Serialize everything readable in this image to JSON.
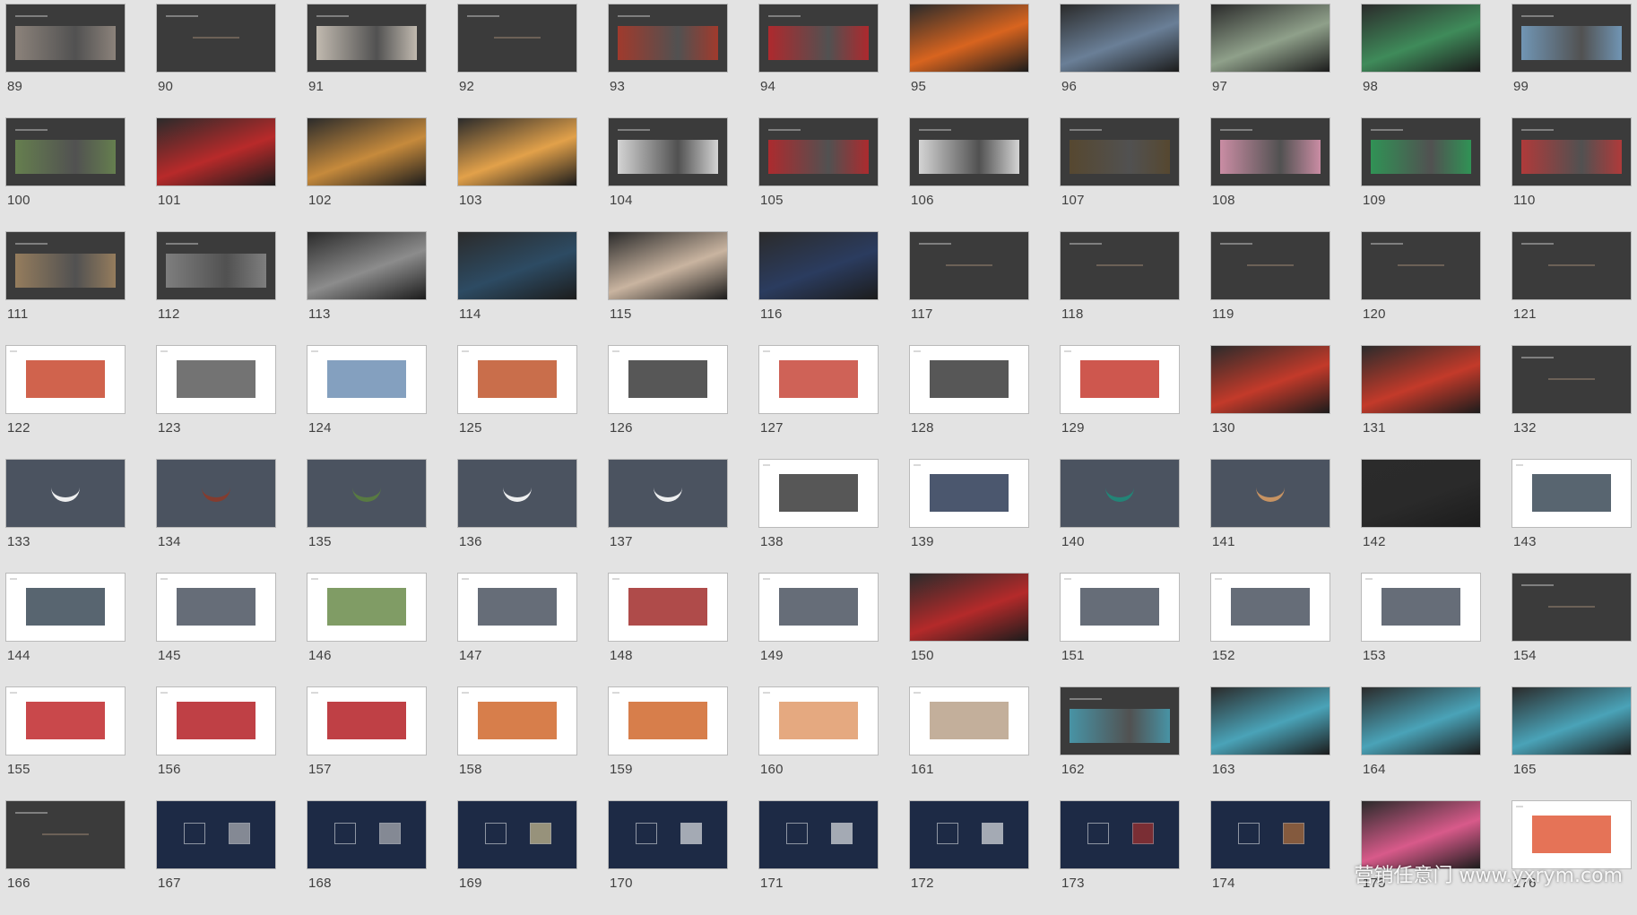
{
  "view": "slide-sorter",
  "slides": [
    {
      "number": "89",
      "theme": "dark",
      "accent": "#9a8f86"
    },
    {
      "number": "90",
      "theme": "dark",
      "accent": ""
    },
    {
      "number": "91",
      "theme": "dark",
      "accent": "#d9d0c4"
    },
    {
      "number": "92",
      "theme": "dark",
      "accent": ""
    },
    {
      "number": "93",
      "theme": "dark",
      "accent": "#b23a2a"
    },
    {
      "number": "94",
      "theme": "dark",
      "accent": "#c2262b"
    },
    {
      "number": "95",
      "theme": "photo",
      "accent": "#d8641f"
    },
    {
      "number": "96",
      "theme": "photo",
      "accent": "#6a7f97"
    },
    {
      "number": "97",
      "theme": "photo",
      "accent": "#8fa08a"
    },
    {
      "number": "98",
      "theme": "photo",
      "accent": "#3f8b5a"
    },
    {
      "number": "99",
      "theme": "dark",
      "accent": "#7aa5c9"
    },
    {
      "number": "100",
      "theme": "dark",
      "accent": "#6d8b52"
    },
    {
      "number": "101",
      "theme": "photo",
      "accent": "#b82a2a"
    },
    {
      "number": "102",
      "theme": "photo",
      "accent": "#c68a3c"
    },
    {
      "number": "103",
      "theme": "photo",
      "accent": "#e2a14a"
    },
    {
      "number": "104",
      "theme": "dark",
      "accent": "#efefef"
    },
    {
      "number": "105",
      "theme": "dark",
      "accent": "#c0282c"
    },
    {
      "number": "106",
      "theme": "dark",
      "accent": "#efefef"
    },
    {
      "number": "107",
      "theme": "dark",
      "accent": "#5b4a2e"
    },
    {
      "number": "108",
      "theme": "dark",
      "accent": "#e39bb6"
    },
    {
      "number": "109",
      "theme": "dark",
      "accent": "#2ea25a"
    },
    {
      "number": "110",
      "theme": "dark",
      "accent": "#c43a3a"
    },
    {
      "number": "111",
      "theme": "dark",
      "accent": "#a58863"
    },
    {
      "number": "112",
      "theme": "dark",
      "accent": "#8a8a8a"
    },
    {
      "number": "113",
      "theme": "photo",
      "accent": "#8c8c8c"
    },
    {
      "number": "114",
      "theme": "photo",
      "accent": "#2d4b63"
    },
    {
      "number": "115",
      "theme": "photo",
      "accent": "#c9b4a0"
    },
    {
      "number": "116",
      "theme": "photo",
      "accent": "#2b3c5f"
    },
    {
      "number": "117",
      "theme": "dark",
      "accent": ""
    },
    {
      "number": "118",
      "theme": "dark",
      "accent": ""
    },
    {
      "number": "119",
      "theme": "dark",
      "accent": ""
    },
    {
      "number": "120",
      "theme": "dark",
      "accent": ""
    },
    {
      "number": "121",
      "theme": "dark",
      "accent": ""
    },
    {
      "number": "122",
      "theme": "white",
      "accent": "#c8482e"
    },
    {
      "number": "123",
      "theme": "white",
      "accent": "#5a5a5a"
    },
    {
      "number": "124",
      "theme": "white",
      "accent": "#6f8fb4"
    },
    {
      "number": "125",
      "theme": "white",
      "accent": "#c0552c"
    },
    {
      "number": "126",
      "theme": "white",
      "accent": "#3a3a3a"
    },
    {
      "number": "127",
      "theme": "white",
      "accent": "#c7473a"
    },
    {
      "number": "128",
      "theme": "white",
      "accent": "#3a3a3a"
    },
    {
      "number": "129",
      "theme": "white",
      "accent": "#c53a2f"
    },
    {
      "number": "130",
      "theme": "photo",
      "accent": "#c33a2a"
    },
    {
      "number": "131",
      "theme": "photo",
      "accent": "#c33a2a"
    },
    {
      "number": "132",
      "theme": "dark",
      "accent": ""
    },
    {
      "number": "133",
      "theme": "slate",
      "accent": "#ffffff"
    },
    {
      "number": "134",
      "theme": "slate",
      "accent": "#8b3a2a"
    },
    {
      "number": "135",
      "theme": "slate",
      "accent": "#5a7f3f"
    },
    {
      "number": "136",
      "theme": "slate",
      "accent": "#ffffff"
    },
    {
      "number": "137",
      "theme": "slate",
      "accent": "#ffffff"
    },
    {
      "number": "138",
      "theme": "white",
      "accent": "#3a3a3a"
    },
    {
      "number": "139",
      "theme": "white",
      "accent": "#2c3a55"
    },
    {
      "number": "140",
      "theme": "slate",
      "accent": "#1f8a7a"
    },
    {
      "number": "141",
      "theme": "slate",
      "accent": "#d59a63"
    },
    {
      "number": "142",
      "theme": "photo",
      "accent": "#2a2a2a"
    },
    {
      "number": "143",
      "theme": "white",
      "accent": "#3b4a57"
    },
    {
      "number": "144",
      "theme": "white",
      "accent": "#3b4a57"
    },
    {
      "number": "145",
      "theme": "white",
      "accent": "#4b5360"
    },
    {
      "number": "146",
      "theme": "white",
      "accent": "#6a8b4a"
    },
    {
      "number": "147",
      "theme": "white",
      "accent": "#4b5360"
    },
    {
      "number": "148",
      "theme": "white",
      "accent": "#a12b2a"
    },
    {
      "number": "149",
      "theme": "white",
      "accent": "#4b5360"
    },
    {
      "number": "150",
      "theme": "photo",
      "accent": "#b42a2a"
    },
    {
      "number": "151",
      "theme": "white",
      "accent": "#4b5360"
    },
    {
      "number": "152",
      "theme": "white",
      "accent": "#4b5360"
    },
    {
      "number": "153",
      "theme": "white",
      "accent": "#4b5360"
    },
    {
      "number": "154",
      "theme": "dark",
      "accent": ""
    },
    {
      "number": "155",
      "theme": "white",
      "accent": "#c0282c"
    },
    {
      "number": "156",
      "theme": "white",
      "accent": "#b41f25"
    },
    {
      "number": "157",
      "theme": "white",
      "accent": "#b41f25"
    },
    {
      "number": "158",
      "theme": "white",
      "accent": "#d0672c"
    },
    {
      "number": "159",
      "theme": "white",
      "accent": "#d0672c"
    },
    {
      "number": "160",
      "theme": "white",
      "accent": "#e09a6a"
    },
    {
      "number": "161",
      "theme": "white",
      "accent": "#b8a18a"
    },
    {
      "number": "162",
      "theme": "dark",
      "accent": "#4aa3b8"
    },
    {
      "number": "163",
      "theme": "photo",
      "accent": "#4aa3b8"
    },
    {
      "number": "164",
      "theme": "photo",
      "accent": "#4aa3b8"
    },
    {
      "number": "165",
      "theme": "photo",
      "accent": "#4aa3b8"
    },
    {
      "number": "166",
      "theme": "dark",
      "accent": ""
    },
    {
      "number": "167",
      "theme": "navy",
      "accent": "#c9c9c9"
    },
    {
      "number": "168",
      "theme": "navy",
      "accent": "#c9c9c9"
    },
    {
      "number": "169",
      "theme": "navy",
      "accent": "#e8d8a0"
    },
    {
      "number": "170",
      "theme": "navy",
      "accent": "#ffffff"
    },
    {
      "number": "171",
      "theme": "navy",
      "accent": "#ffffff"
    },
    {
      "number": "172",
      "theme": "navy",
      "accent": "#ffffff"
    },
    {
      "number": "173",
      "theme": "navy",
      "accent": "#b8322a"
    },
    {
      "number": "174",
      "theme": "navy",
      "accent": "#c97a3a"
    },
    {
      "number": "175",
      "theme": "photo",
      "accent": "#d85a8a"
    },
    {
      "number": "176",
      "theme": "white",
      "accent": "#e05a3a"
    }
  ],
  "watermark": "营销任意门 www.yxrym.com"
}
